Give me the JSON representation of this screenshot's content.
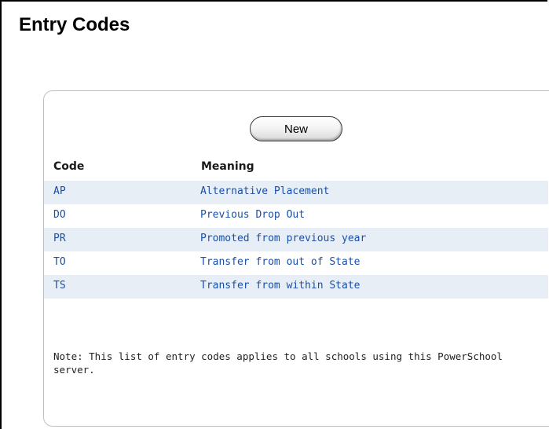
{
  "page": {
    "title": "Entry Codes"
  },
  "toolbar": {
    "new_label": "New"
  },
  "table": {
    "headers": {
      "code": "Code",
      "meaning": "Meaning"
    },
    "rows": [
      {
        "code": "AP",
        "meaning": "Alternative Placement"
      },
      {
        "code": "DO",
        "meaning": "Previous Drop Out"
      },
      {
        "code": "PR",
        "meaning": "Promoted from previous year"
      },
      {
        "code": "TO",
        "meaning": "Transfer from out of State"
      },
      {
        "code": "TS",
        "meaning": "Transfer from within State"
      }
    ]
  },
  "footer": {
    "note": "Note: This list of entry codes applies to all schools using this PowerSchool server."
  },
  "colors": {
    "link": "#1a4fa8",
    "row_shade": "#e8eef6",
    "box_border": "#bfbfbf"
  }
}
